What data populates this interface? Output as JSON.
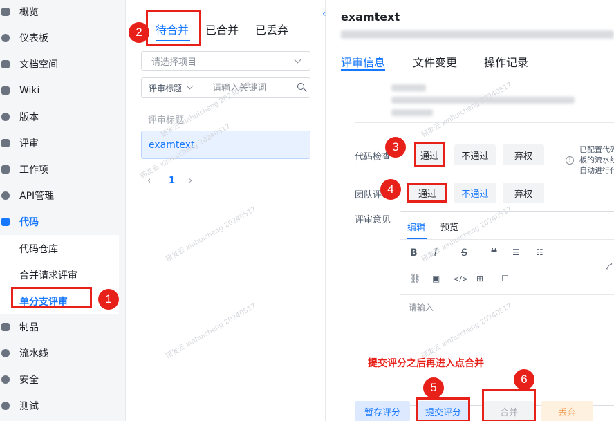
{
  "nav": {
    "items": [
      {
        "label": "概览",
        "icon": "grid-icon"
      },
      {
        "label": "仪表板",
        "icon": "dashboard-icon"
      },
      {
        "label": "文档空间",
        "icon": "doc-icon"
      },
      {
        "label": "Wiki",
        "icon": "wiki-icon"
      },
      {
        "label": "版本",
        "icon": "version-icon"
      },
      {
        "label": "评审",
        "icon": "review-icon"
      },
      {
        "label": "工作项",
        "icon": "task-icon"
      },
      {
        "label": "API管理",
        "icon": "share-icon"
      },
      {
        "label": "代码",
        "icon": "code-icon"
      },
      {
        "label": "制品",
        "icon": "artifact-icon"
      },
      {
        "label": "流水线",
        "icon": "pipeline-icon"
      },
      {
        "label": "安全",
        "icon": "shield-icon"
      },
      {
        "label": "测试",
        "icon": "test-icon"
      }
    ],
    "sub_items": [
      "代码仓库",
      "合并请求评审",
      "单分支评审"
    ],
    "accent": "#1677ff"
  },
  "list_panel": {
    "tabs": [
      "待合并",
      "已合并",
      "已丢弃"
    ],
    "project_select_placeholder": "请选择项目",
    "search_type": "评审标题",
    "search_placeholder": "请输入关键词",
    "column_header": "评审标题",
    "rows": [
      "examtext"
    ],
    "page": "1"
  },
  "detail": {
    "title": "examtext",
    "tabs": [
      "评审信息",
      "文件变更",
      "操作记录"
    ],
    "code_check": {
      "label": "代码检查",
      "options": [
        "通过",
        "不通过",
        "弃权"
      ],
      "note_lines": [
        "已配置代码",
        "板的流水线",
        "自动进行代"
      ]
    },
    "team_review": {
      "label": "团队评审",
      "options": [
        "通过",
        "不通过",
        "弃权"
      ]
    },
    "comment": {
      "label": "评审意见",
      "tabs": [
        "编辑",
        "预览"
      ],
      "placeholder": "请输入"
    },
    "footer": {
      "save_draft": "暂存评分",
      "submit": "提交评分",
      "merge": "合并",
      "discard": "丢弃"
    }
  },
  "annotations": {
    "numbers": [
      "1",
      "2",
      "3",
      "4",
      "5",
      "6"
    ],
    "note": "提交评分之后再进入点合并",
    "color": "#e8201a"
  }
}
